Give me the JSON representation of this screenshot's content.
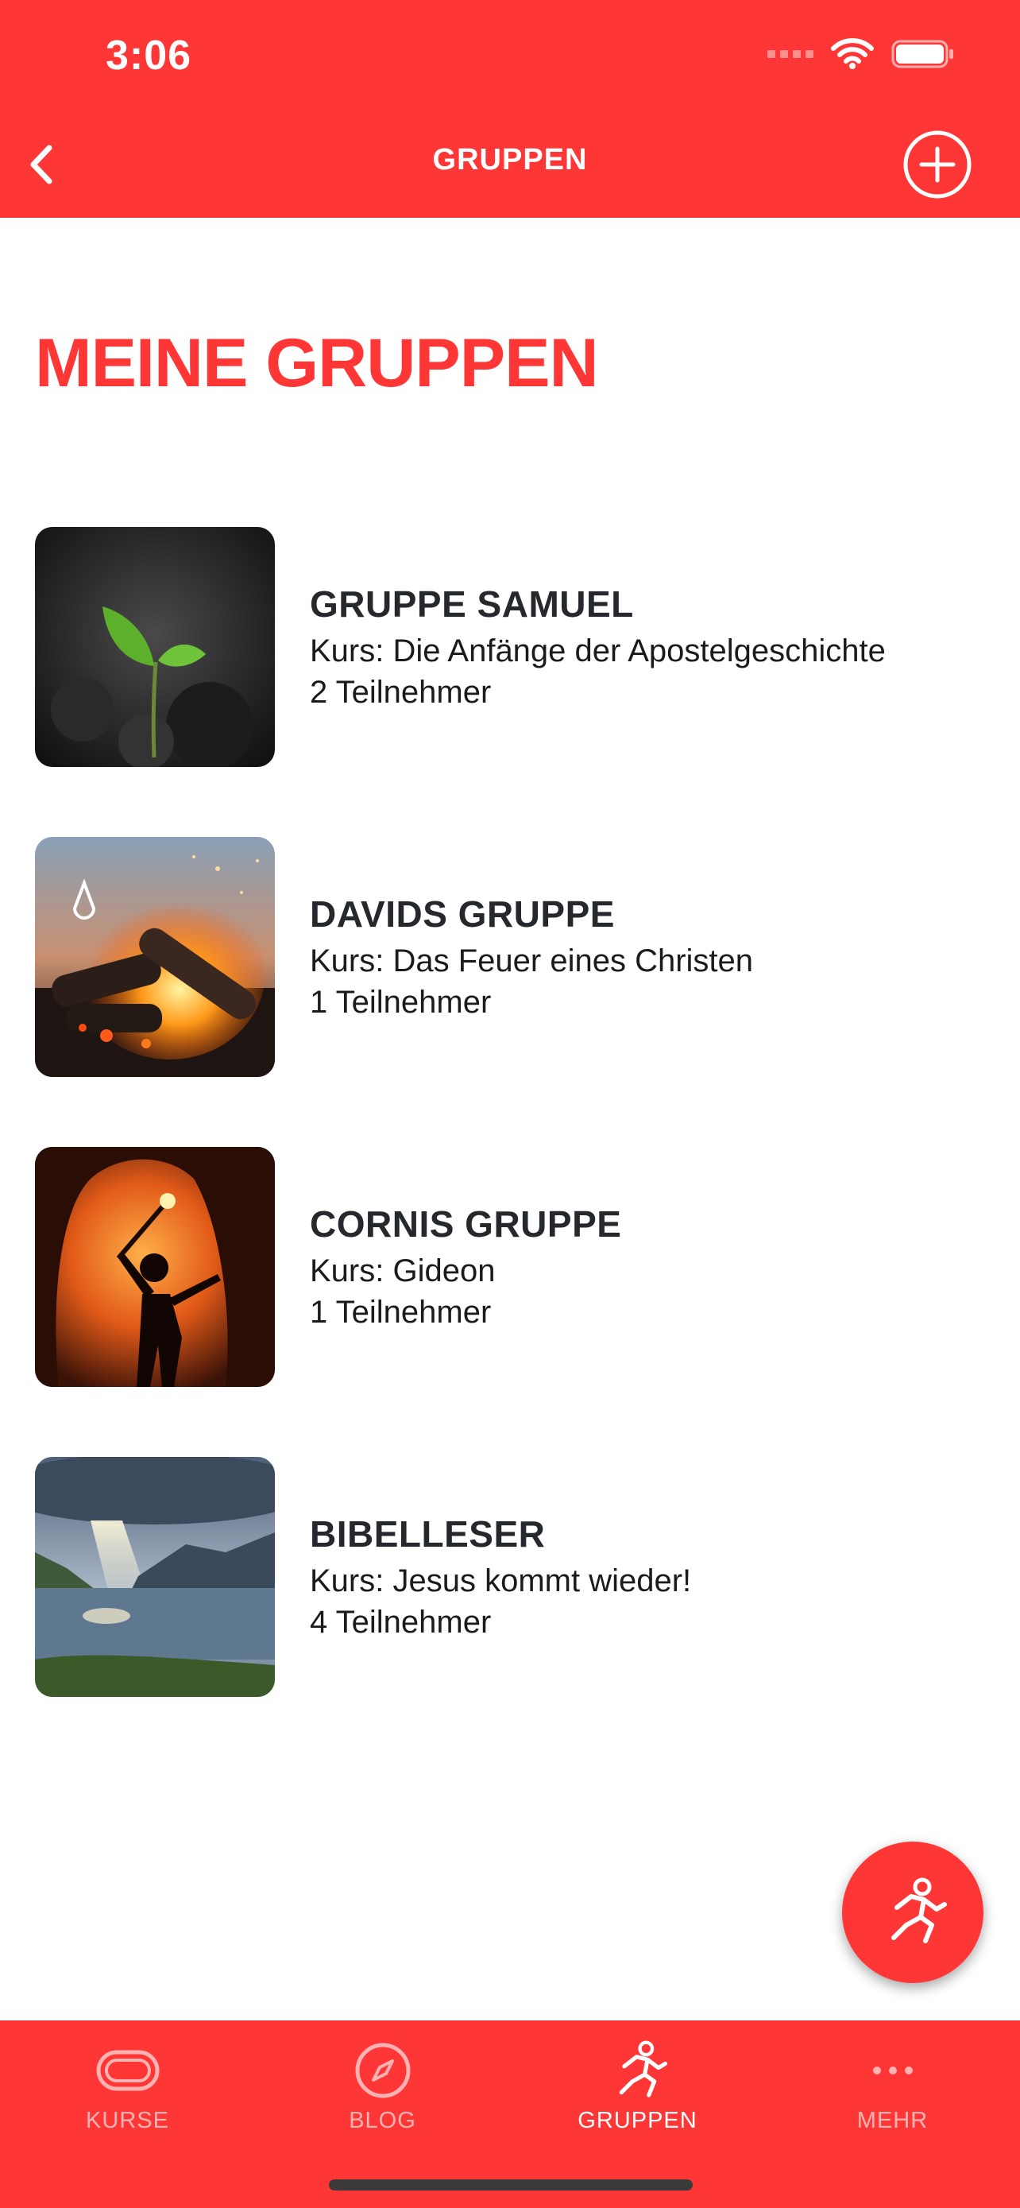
{
  "status": {
    "time": "3:06"
  },
  "nav": {
    "title": "GRUPPEN"
  },
  "page": {
    "title": "MEINE GRUPPEN"
  },
  "groups": [
    {
      "name": "GRUPPE SAMUEL",
      "course": "Kurs: Die Anfänge der Apostelgeschichte",
      "members": "2 Teilnehmer",
      "image": "sprout-photo"
    },
    {
      "name": "DAVIDS GRUPPE",
      "course": "Kurs: Das Feuer eines Christen",
      "members": "1 Teilnehmer",
      "image": "campfire-photo"
    },
    {
      "name": "CORNIS GRUPPE",
      "course": "Kurs: Gideon",
      "members": "1 Teilnehmer",
      "image": "cave-torch-photo"
    },
    {
      "name": "BIBELLESER",
      "course": "Kurs: Jesus kommt wieder!",
      "members": "4 Teilnehmer",
      "image": "lake-sunbeam-photo"
    }
  ],
  "tabs": [
    {
      "label": "KURSE",
      "icon": "track-icon"
    },
    {
      "label": "BLOG",
      "icon": "compass-icon"
    },
    {
      "label": "GRUPPEN",
      "icon": "runner-icon",
      "active": true
    },
    {
      "label": "MEHR",
      "icon": "more-icon"
    }
  ],
  "colors": {
    "brand": "#ff3636",
    "text": "#25282c"
  }
}
